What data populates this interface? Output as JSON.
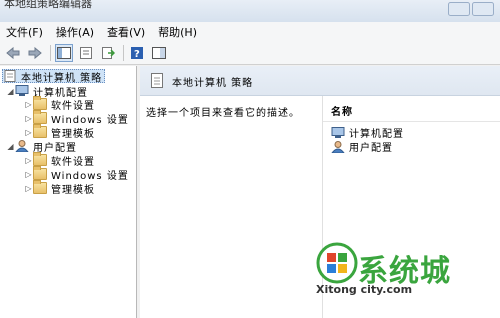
{
  "window": {
    "title": "本地组策略编辑器"
  },
  "menu": [
    "文件(F)",
    "操作(A)",
    "查看(V)",
    "帮助(H)"
  ],
  "tree": {
    "root": "本地计算机 策略",
    "computer_config": "计算机配置",
    "user_config": "用户配置",
    "software": "软件设置",
    "windows": "Windows 设置",
    "admin_templates": "管理模板"
  },
  "right": {
    "header": "本地计算机 策略",
    "description": "选择一个项目来查看它的描述。",
    "column_name": "名称",
    "items": [
      "计算机配置",
      "用户配置"
    ]
  },
  "watermark": {
    "main": "系统城",
    "site": "Xitong city.com"
  },
  "colors": {
    "accent": "#3aa53e",
    "selection": "#cfe3f7",
    "folder": "#e8c06a"
  }
}
